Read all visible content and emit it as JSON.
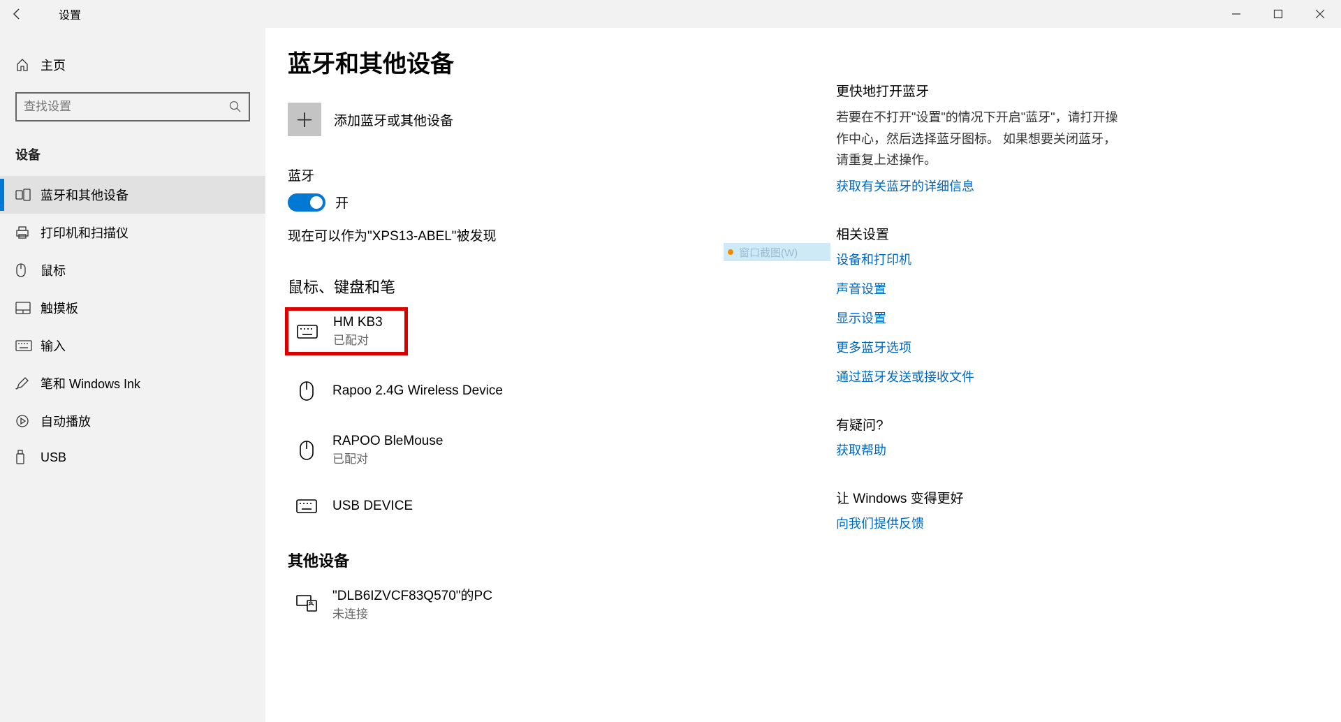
{
  "window": {
    "title": "设置"
  },
  "sidebar": {
    "home_label": "主页",
    "search_placeholder": "查找设置",
    "section_header": "设备",
    "items": [
      {
        "label": "蓝牙和其他设备",
        "icon": "bluetooth-devices-icon",
        "active": true
      },
      {
        "label": "打印机和扫描仪",
        "icon": "printer-icon",
        "active": false
      },
      {
        "label": "鼠标",
        "icon": "mouse-icon",
        "active": false
      },
      {
        "label": "触摸板",
        "icon": "touchpad-icon",
        "active": false
      },
      {
        "label": "输入",
        "icon": "keyboard-icon",
        "active": false
      },
      {
        "label": "笔和 Windows Ink",
        "icon": "pen-icon",
        "active": false
      },
      {
        "label": "自动播放",
        "icon": "autoplay-icon",
        "active": false
      },
      {
        "label": "USB",
        "icon": "usb-icon",
        "active": false
      }
    ]
  },
  "main": {
    "page_title": "蓝牙和其他设备",
    "add_device_label": "添加蓝牙或其他设备",
    "bluetooth_label": "蓝牙",
    "toggle_on_text": "开",
    "discoverable_text": "现在可以作为\"XPS13-ABEL\"被发现",
    "section_mkp": "鼠标、键盘和笔",
    "devices_mkp": [
      {
        "name": "HM KB3",
        "status": "已配对",
        "icon": "keyboard",
        "highlight": true
      },
      {
        "name": "Rapoo 2.4G Wireless Device",
        "status": "",
        "icon": "mouse",
        "highlight": false
      },
      {
        "name": "RAPOO BleMouse",
        "status": "已配对",
        "icon": "mouse",
        "highlight": false
      },
      {
        "name": "USB DEVICE",
        "status": "",
        "icon": "keyboard",
        "highlight": false
      }
    ],
    "section_other": "其他设备",
    "devices_other": [
      {
        "name": "\"DLB6IZVCF83Q570\"的PC",
        "status": "未连接",
        "icon": "pc"
      }
    ]
  },
  "help": {
    "quick_header": "更快地打开蓝牙",
    "quick_body": "若要在不打开\"设置\"的情况下开启\"蓝牙\"，请打开操作中心，然后选择蓝牙图标。 如果想要关闭蓝牙，请重复上述操作。",
    "quick_link": "获取有关蓝牙的详细信息",
    "related_header": "相关设置",
    "related_links": [
      "设备和打印机",
      "声音设置",
      "显示设置",
      "更多蓝牙选项",
      "通过蓝牙发送或接收文件"
    ],
    "question_header": "有疑问?",
    "question_link": "获取帮助",
    "better_header": "让 Windows 变得更好",
    "better_link": "向我们提供反馈"
  },
  "overlay": {
    "hint_text": "窗口截图(W)"
  }
}
